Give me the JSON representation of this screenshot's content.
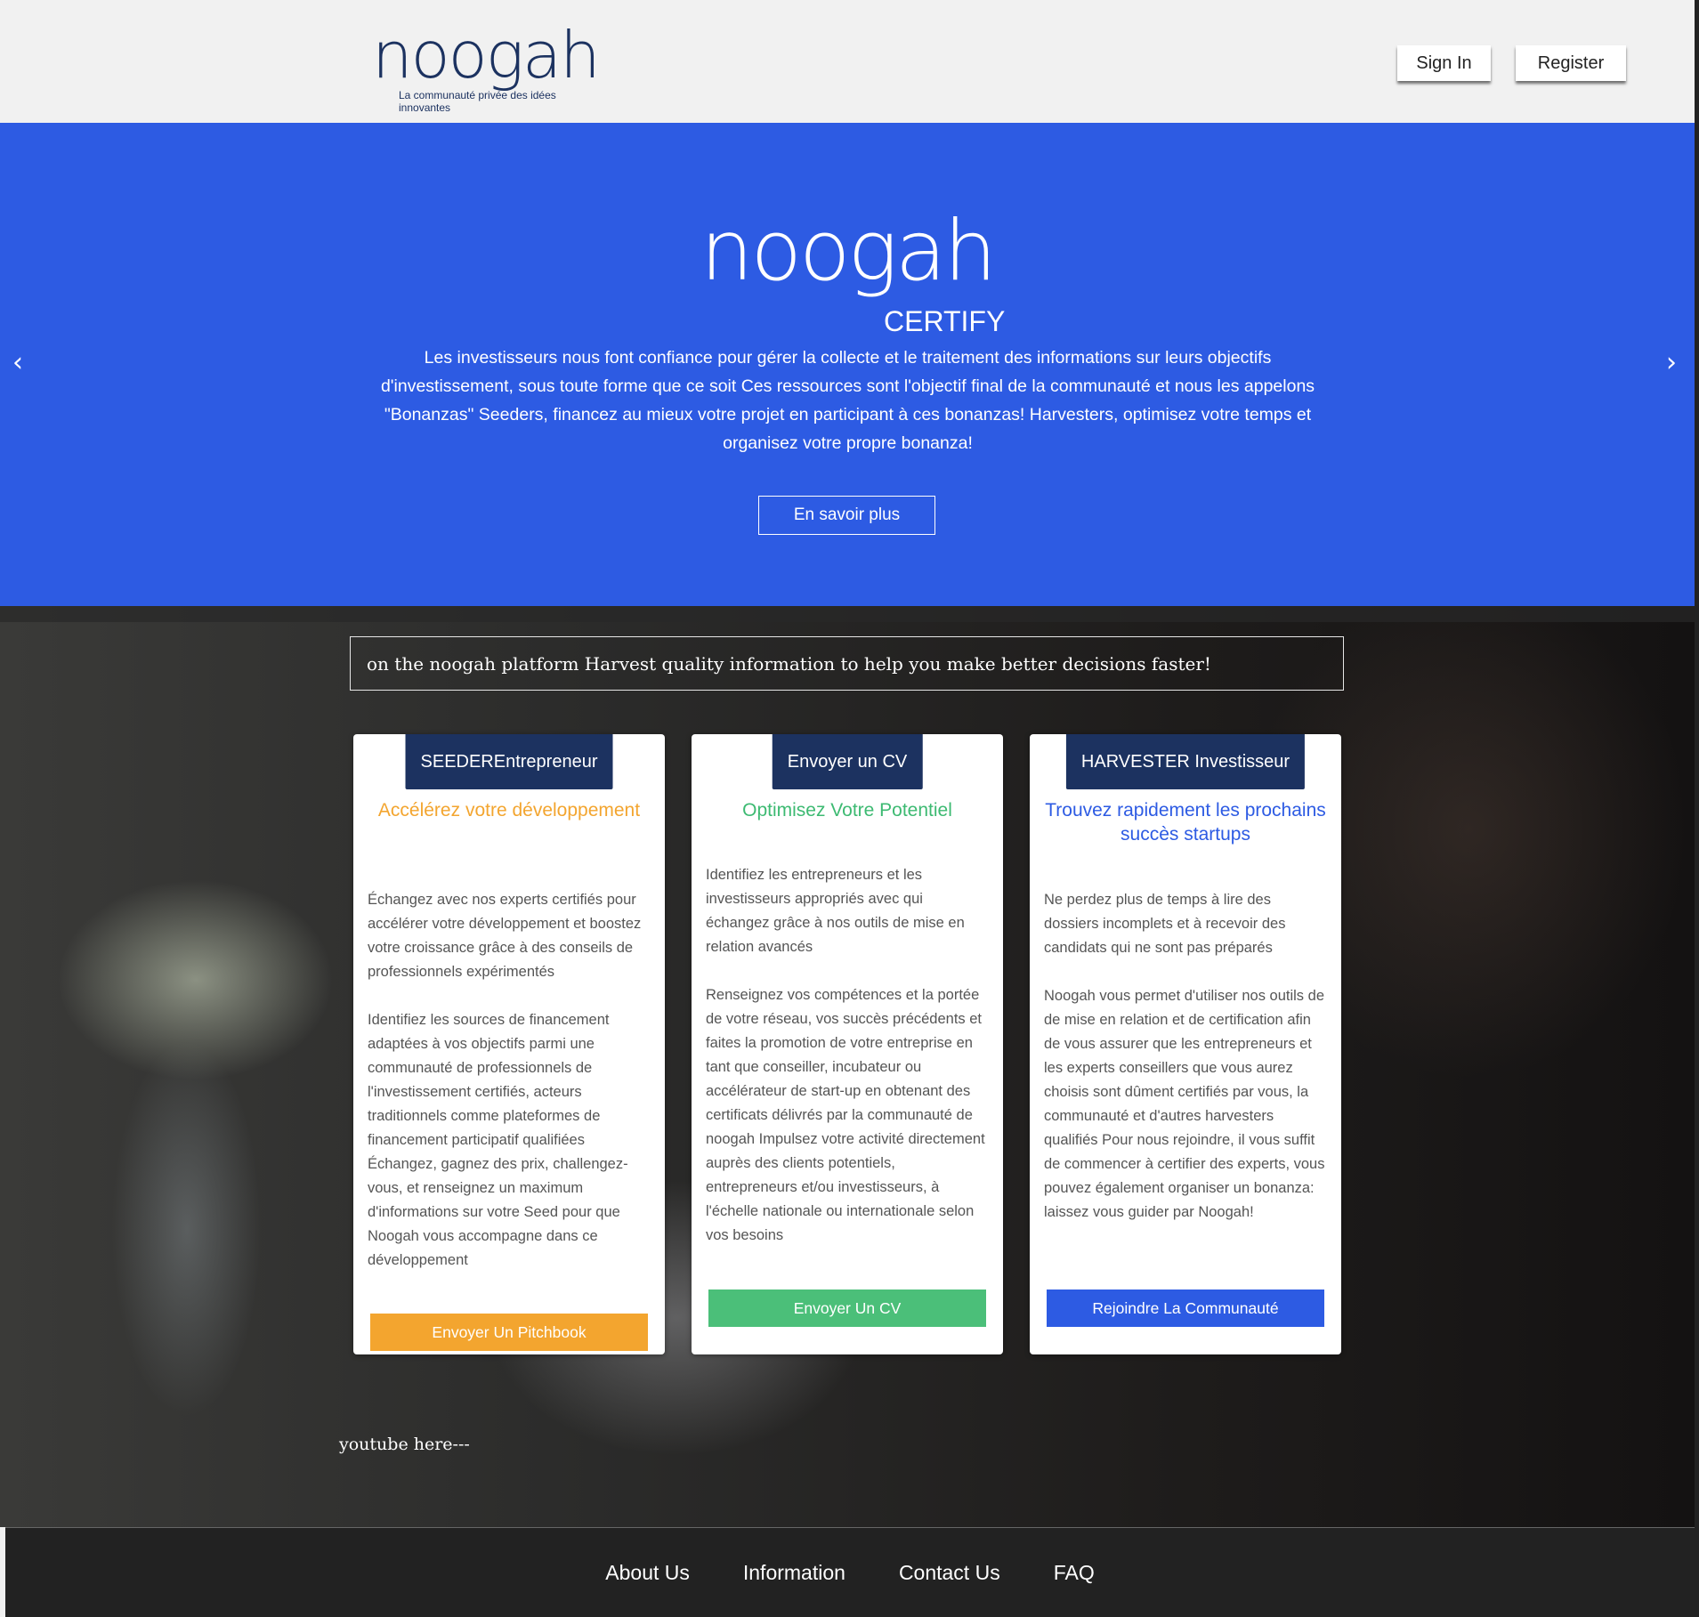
{
  "header": {
    "logo_word": "noogah",
    "logo_tagline": "La communauté privée des idées innovantes",
    "signin_label": "Sign In",
    "register_label": "Register"
  },
  "hero": {
    "logo_word": "noogah",
    "subtitle": "CERTIFY",
    "text": "Les investisseurs nous font confiance pour gérer la collecte et le traitement des informations sur leurs objectifs d'investissement, sous toute forme que ce soit Ces ressources sont l'objectif final de la communauté et nous les appelons \"Bonanzas\" Seeders, financez au mieux votre projet en participant à ces bonanzas! Harvesters, optimisez votre temps et organisez votre propre bonanza!",
    "button_label": "En savoir plus",
    "prev_arrow": "‹",
    "next_arrow": "›"
  },
  "tagline": "on the noogah platform Harvest quality information to help you make better decisions faster!",
  "cards": [
    {
      "badge": "SEEDEREntrepreneur",
      "heading": "Accélérez votre développement",
      "paragraphs": [
        "Échangez avec nos experts certifiés pour accélérer votre développement et boostez votre croissance grâce à des conseils de professionnels expérimentés",
        "Identifiez les sources de financement adaptées à vos objectifs parmi une communauté de professionnels de l'investissement certifiés, acteurs traditionnels comme plateformes de financement participatif qualifiées Échangez, gagnez des prix, challengez-vous, et renseignez un maximum d'informations sur votre Seed pour que Noogah vous accompagne dans ce développement"
      ],
      "button_label": "Envoyer Un Pitchbook"
    },
    {
      "badge": "Envoyer un CV",
      "heading": "Optimisez Votre Potentiel",
      "paragraphs": [
        "Identifiez les entrepreneurs et les investisseurs appropriés avec qui échangez grâce à nos outils de mise en relation avancés",
        "Renseignez vos compétences et la portée de votre réseau, vos succès précédents et faites la promotion de votre entreprise en tant que conseiller, incubateur ou accélérateur de start-up en obtenant des certificats délivrés par la communauté de noogah Impulsez votre activité directement auprès des clients potentiels, entrepreneurs et/ou investisseurs, à l'échelle nationale ou internationale selon vos besoins"
      ],
      "button_label": "Envoyer Un CV"
    },
    {
      "badge": "HARVESTER Investisseur",
      "heading": "Trouvez rapidement les prochains succès startups",
      "paragraphs": [
        "Ne perdez plus de temps à lire des dossiers incomplets et à recevoir des candidats qui ne sont pas préparés",
        "Noogah vous permet d'utiliser nos outils de de mise en relation et de certification afin de vous assurer que les entrepreneurs et les experts conseillers que vous aurez choisis sont dûment certifiés par vous, la communauté et d'autres harvesters qualifiés  Pour nous rejoindre, il vous suffit de commencer à certifier des experts, vous pouvez également organiser un bonanza: laissez vous guider par Noogah!"
      ],
      "button_label": "Rejoindre La Communauté"
    }
  ],
  "youtube_placeholder": "youtube here---",
  "footer": {
    "links": [
      "About Us",
      "Information",
      "Contact Us",
      "FAQ"
    ]
  },
  "colors": {
    "brand_navy": "#1c3260",
    "hero_blue": "#2d5be3",
    "seeder_orange": "#f3a52f",
    "cv_green": "#4bbf79",
    "harvester_blue": "#2d5be3",
    "footer_bg": "#222222"
  }
}
